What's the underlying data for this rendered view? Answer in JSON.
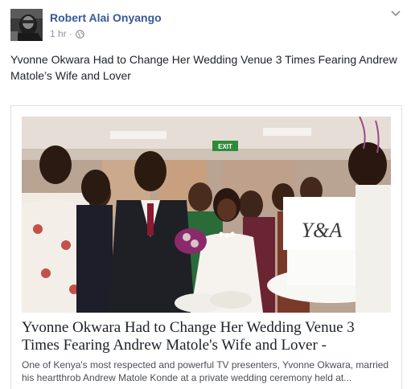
{
  "post": {
    "author": "Robert Alai Onyango",
    "time": "1 hr",
    "separator": "·",
    "privacy_icon": "globe-icon",
    "menu_icon": "chevron-down-icon",
    "text": "Yvonne Okwara Had to Change Her Wedding Venue 3 Times Fearing Andrew Matole’s Wife and Lover"
  },
  "link_card": {
    "image_icon": "wedding-photo",
    "title": "Yvonne Okwara Had to Change Her Wedding Venue 3 Times Fearing Andrew Matole's Wife and Lover -",
    "description": "One of Kenya's most respected and powerful TV presenters, Yvonne Okwara, married his heartthrob Andrew Matole Konde at a private wedding ceremony held at...",
    "exit_sign": "EXIT",
    "cake_monogram": "Y&A"
  },
  "colors": {
    "author_link": "#365899",
    "meta_gray": "#90949c",
    "text": "#1d2129",
    "card_border": "#dddfe2"
  }
}
